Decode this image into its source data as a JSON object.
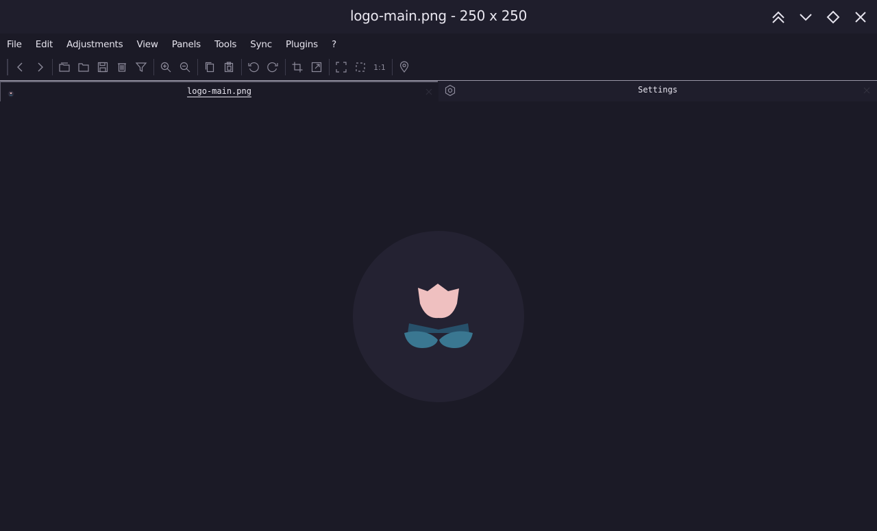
{
  "window": {
    "title": "logo-main.png - 250 x 250",
    "controls": [
      "collapse-up-icon",
      "chevron-down-icon",
      "diamond-icon",
      "close-icon"
    ]
  },
  "menu": {
    "items": [
      "File",
      "Edit",
      "Adjustments",
      "View",
      "Panels",
      "Tools",
      "Sync",
      "Plugins",
      "?"
    ]
  },
  "toolbar": {
    "icons": [
      "back-icon",
      "forward-icon",
      "open-recent-icon",
      "open-folder-icon",
      "save-icon",
      "delete-icon",
      "filter-icon",
      "zoom-in-icon",
      "zoom-out-icon",
      "copy-icon",
      "paste-icon",
      "rotate-left-icon",
      "rotate-right-icon",
      "crop-icon",
      "resize-icon",
      "fullscreen-icon",
      "selection-icon",
      "actual-size-icon",
      "location-pin-icon"
    ],
    "actual_size_label": "1:1"
  },
  "tabs": {
    "image_tab_label": "logo-main.png",
    "settings_tab_label": "Settings"
  },
  "image": {
    "filename": "logo-main.png",
    "width": 250,
    "height": 250
  },
  "colors": {
    "background": "#1b1a26",
    "titlebar": "#1f1e2c",
    "logo_circle": "#242232",
    "petal": "#efc0c0",
    "leaf_dark": "#27506a",
    "leaf_light": "#3a7791",
    "text": "#e6e4ee"
  }
}
